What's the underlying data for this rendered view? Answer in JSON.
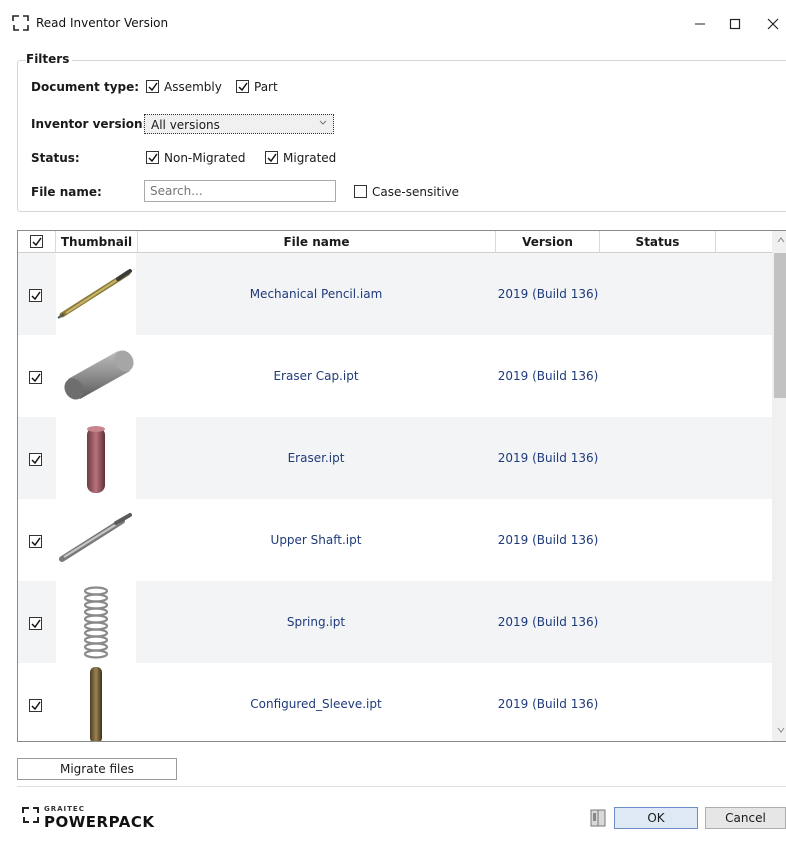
{
  "window": {
    "title": "Read Inventor Version",
    "minimize_label": "–",
    "maximize_label": "☐",
    "close_label": "✕"
  },
  "filters": {
    "legend": "Filters",
    "document_type": {
      "label": "Document type:",
      "options": [
        {
          "label": "Assembly",
          "checked": true
        },
        {
          "label": "Part",
          "checked": true
        }
      ]
    },
    "inventor_version": {
      "label": "Inventor version:",
      "selected": "All versions"
    },
    "status": {
      "label": "Status:",
      "options": [
        {
          "label": "Non-Migrated",
          "checked": true
        },
        {
          "label": "Migrated",
          "checked": true
        }
      ]
    },
    "file_name": {
      "label": "File name:",
      "value": "",
      "placeholder": "Search...",
      "case_sensitive_label": "Case-sensitive",
      "case_sensitive_checked": false
    }
  },
  "table": {
    "header_checked": true,
    "columns": [
      "Thumbnail",
      "File name",
      "Version",
      "Status"
    ],
    "rows": [
      {
        "checked": true,
        "thumbnail": "pencil-assembly-thumbnail",
        "file_name": "Mechanical Pencil.iam",
        "version": "2019 (Build 136)",
        "status": ""
      },
      {
        "checked": true,
        "thumbnail": "cylinder-thumbnail",
        "file_name": "Eraser Cap.ipt",
        "version": "2019 (Build 136)",
        "status": ""
      },
      {
        "checked": true,
        "thumbnail": "eraser-thumbnail",
        "file_name": "Eraser.ipt",
        "version": "2019 (Build 136)",
        "status": ""
      },
      {
        "checked": true,
        "thumbnail": "shaft-thumbnail",
        "file_name": "Upper Shaft.ipt",
        "version": "2019 (Build 136)",
        "status": ""
      },
      {
        "checked": true,
        "thumbnail": "spring-thumbnail",
        "file_name": "Spring.ipt",
        "version": "2019 (Build 136)",
        "status": ""
      },
      {
        "checked": true,
        "thumbnail": "sleeve-thumbnail",
        "file_name": "Configured_Sleeve.ipt",
        "version": "2019 (Build 136)",
        "status": ""
      }
    ]
  },
  "footer": {
    "migrate_label": "Migrate files",
    "brand_small": "GRAITEC",
    "brand_big": "POWERPACK",
    "ok_label": "OK",
    "cancel_label": "Cancel"
  },
  "colors": {
    "link_text": "#1f3a7a",
    "ok_bg": "#dfe9f5",
    "row_alt": "#f3f4f6"
  }
}
